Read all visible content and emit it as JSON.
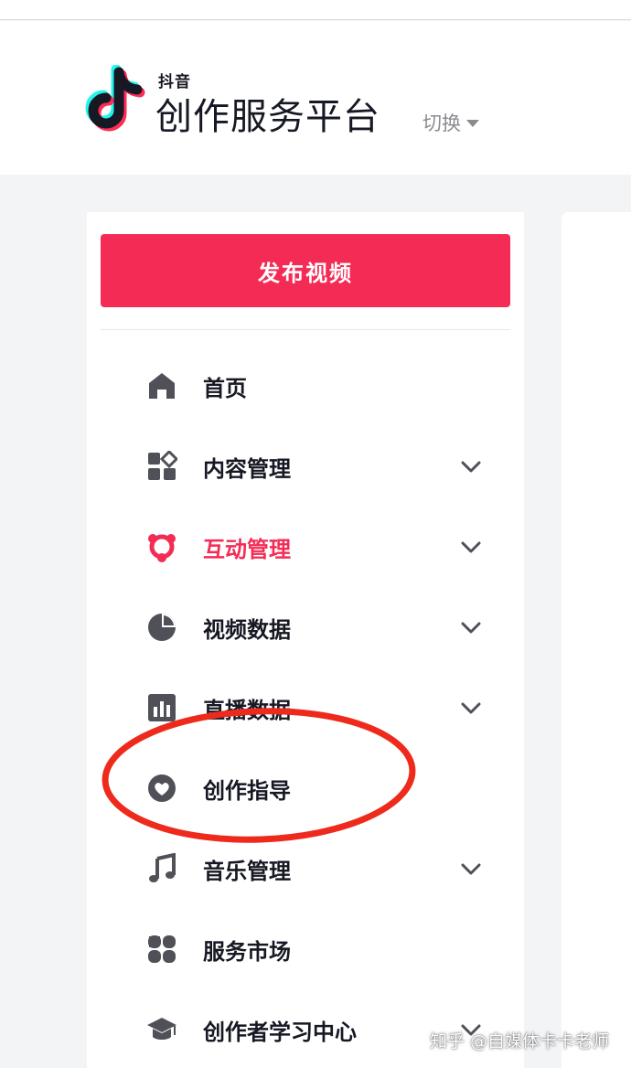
{
  "header": {
    "brand_small": "抖音",
    "brand_title": "创作服务平台",
    "switch_label": "切换"
  },
  "sidebar": {
    "publish_button": "发布视频",
    "items": [
      {
        "label": "首页",
        "icon": "home-icon",
        "has_chevron": false,
        "active": false
      },
      {
        "label": "内容管理",
        "icon": "content-grid-icon",
        "has_chevron": true,
        "active": false
      },
      {
        "label": "互动管理",
        "icon": "interaction-icon",
        "has_chevron": true,
        "active": true
      },
      {
        "label": "视频数据",
        "icon": "pie-chart-icon",
        "has_chevron": true,
        "active": false
      },
      {
        "label": "直播数据",
        "icon": "bar-chart-icon",
        "has_chevron": true,
        "active": false
      },
      {
        "label": "创作指导",
        "icon": "heart-circle-icon",
        "has_chevron": false,
        "active": false
      },
      {
        "label": "音乐管理",
        "icon": "music-note-icon",
        "has_chevron": true,
        "active": false
      },
      {
        "label": "服务市场",
        "icon": "service-market-icon",
        "has_chevron": false,
        "active": false
      },
      {
        "label": "创作者学习中心",
        "icon": "graduation-cap-icon",
        "has_chevron": true,
        "active": false
      }
    ]
  },
  "colors": {
    "accent": "#f42c55",
    "icon_gray": "#505158",
    "annotation_red": "#ee2a1c"
  },
  "watermark": "知乎 @自媒体卡卡老师"
}
